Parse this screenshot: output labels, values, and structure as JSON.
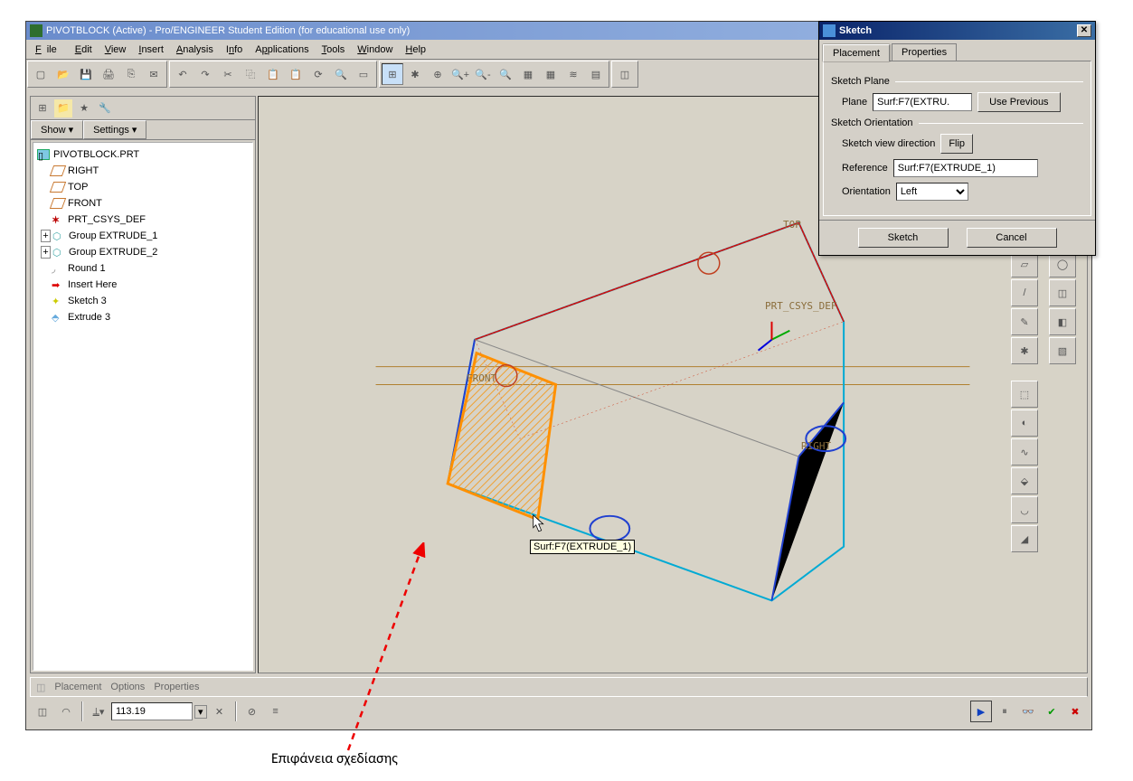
{
  "window": {
    "title": "PIVOTBLOCK (Active) - Pro/ENGINEER Student Edition (for educational use only)"
  },
  "menus": {
    "file": "File",
    "edit": "Edit",
    "view": "View",
    "insert": "Insert",
    "analysis": "Analysis",
    "info": "Info",
    "applications": "Applications",
    "tools": "Tools",
    "window": "Window",
    "help": "Help"
  },
  "nav": {
    "show": "Show ▾",
    "settings": "Settings ▾"
  },
  "tree": {
    "root": "PIVOTBLOCK.PRT",
    "right": "RIGHT",
    "top": "TOP",
    "front": "FRONT",
    "csys": "PRT_CSYS_DEF",
    "g1": "Group EXTRUDE_1",
    "g2": "Group EXTRUDE_2",
    "round": "Round 1",
    "insert": "Insert Here",
    "sketch": "Sketch 3",
    "extrude": "Extrude 3"
  },
  "viewport": {
    "label_top": "TOP",
    "label_right": "RIGHT",
    "label_front": "FRONT",
    "label_csys": "PRT_CSYS_DEF",
    "tooltip_prefix": "Surf:",
    "tooltip": "F7(EXTRUDE_1)"
  },
  "bottom_tabs": {
    "placement": "Placement",
    "options": "Options",
    "properties": "Properties"
  },
  "bottom_input_value": "113.19",
  "dialog": {
    "title": "Sketch",
    "tab_placement": "Placement",
    "tab_properties": "Properties",
    "group_plane": "Sketch Plane",
    "plane_label": "Plane",
    "plane_value": "Surf:F7(EXTRU.",
    "use_prev": "Use Previous",
    "group_orient": "Sketch Orientation",
    "view_dir_label": "Sketch view direction",
    "flip": "Flip",
    "ref_label": "Reference",
    "ref_value": "Surf:F7(EXTRUDE_1)",
    "orient_label": "Orientation",
    "orient_value": "Left",
    "btn_sketch": "Sketch",
    "btn_cancel": "Cancel"
  },
  "annotation": "Επιφάνεια σχεδίασης"
}
